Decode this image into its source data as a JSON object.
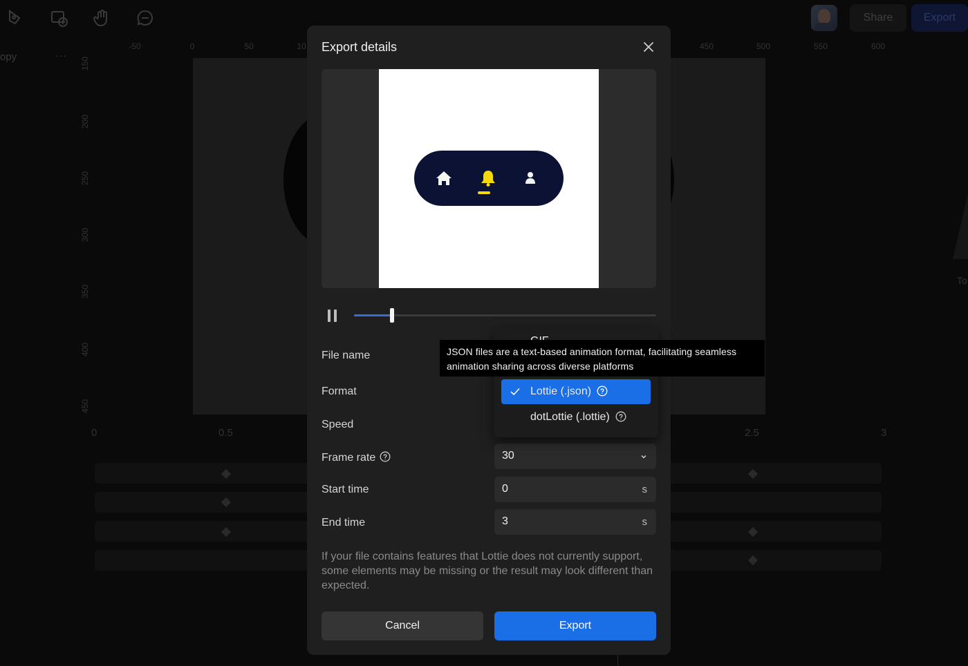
{
  "app": {
    "doc_name": "opy",
    "doc_more": "···",
    "share_label": "Share",
    "export_label": "Export",
    "toolbar_icons": [
      "pen-icon",
      "add-frame-icon",
      "hand-icon",
      "comment-icon"
    ],
    "ruler_h": [
      "-50",
      "0",
      "50",
      "10",
      "450",
      "500",
      "550",
      "600"
    ],
    "ruler_v": [
      "150",
      "200",
      "250",
      "300",
      "350",
      "400",
      "450"
    ],
    "timeline_ticks": [
      "0",
      "0.5",
      "2.5",
      "3"
    ],
    "right_panel_text": "To"
  },
  "modal": {
    "title": "Export details",
    "preview": {
      "pill_color": "#0b1233",
      "active_color": "#f5d90a",
      "icons": [
        "home-icon",
        "bell-icon",
        "user-icon"
      ]
    },
    "player": {
      "progress": 0.127
    },
    "rows": {
      "file_name_label": "File name",
      "format_label": "Format",
      "speed_label": "Speed",
      "frame_rate_label": "Frame rate",
      "frame_rate_value": "30",
      "start_time_label": "Start time",
      "start_time_value": "0",
      "start_time_unit": "s",
      "end_time_label": "End time",
      "end_time_value": "3",
      "end_time_unit": "s"
    },
    "note": "If your file contains features that Lottie does not currently support, some elements may be missing or the result may look different than expected.",
    "cancel_label": "Cancel",
    "export_label": "Export"
  },
  "format_dropdown": {
    "items": [
      {
        "label": "GIF"
      },
      {
        "label": "Lottie (.json)",
        "selected": true
      },
      {
        "label": "dotLottie (.lottie)"
      }
    ]
  },
  "tooltip": {
    "text": "JSON files are a text-based animation format, facilitating seamless animation sharing across diverse platforms"
  },
  "colors": {
    "accent": "#1a6ee6",
    "modal_bg": "#1f1f1f"
  }
}
